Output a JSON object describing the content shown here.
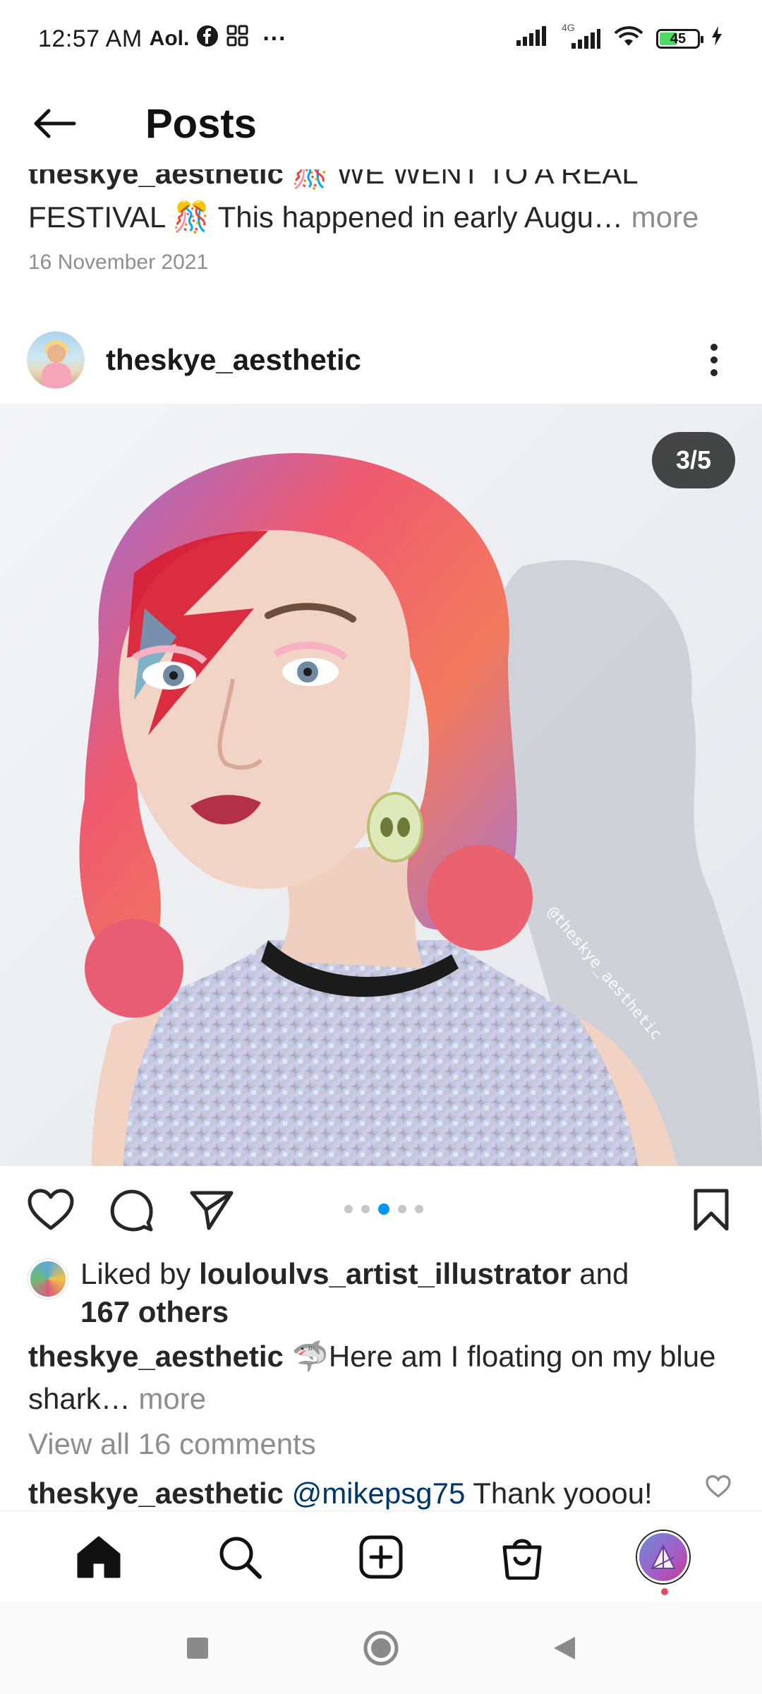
{
  "status_bar": {
    "time": "12:57 AM",
    "carrier_label": "Aol.",
    "overflow": "···",
    "network_label": "4G",
    "battery_level": "45"
  },
  "header": {
    "title": "Posts",
    "back_icon": "arrow-left-icon"
  },
  "previous_post": {
    "username": "theskye_aesthetic",
    "caption_text": " 🎊 WE WENT TO A REAL FESTIVAL 🎊 This happened in early Augu…",
    "more_label": " more",
    "date": "16 November 2021"
  },
  "post": {
    "username": "theskye_aesthetic",
    "more_icon": "more-vertical-icon",
    "carousel_counter": "3/5",
    "carousel_total": 5,
    "carousel_index": 3,
    "image_watermark": "@theskye_aesthetic",
    "likes": {
      "prefix": "Liked by ",
      "liker": "louloulvs_artist_illustrator",
      "middle": " and",
      "others": "167 others"
    },
    "caption": {
      "username": "theskye_aesthetic",
      "text": " 🦈Here am I floating on my blue shark…",
      "more_label": " more"
    },
    "view_comments": "View all 16 comments",
    "comment": {
      "username": "theskye_aesthetic",
      "mention": "@mikepsg75",
      "text": " Thank yooou!"
    }
  },
  "actions": {
    "like_icon": "heart-icon",
    "comment_icon": "comment-icon",
    "share_icon": "send-icon",
    "save_icon": "bookmark-icon"
  },
  "bottom_nav": {
    "items": [
      "home-icon",
      "search-icon",
      "create-icon",
      "shop-icon",
      "profile-avatar"
    ]
  },
  "colors": {
    "accent": "#0095f6",
    "notification": "#ed4956",
    "muted": "#8e8e8e"
  }
}
